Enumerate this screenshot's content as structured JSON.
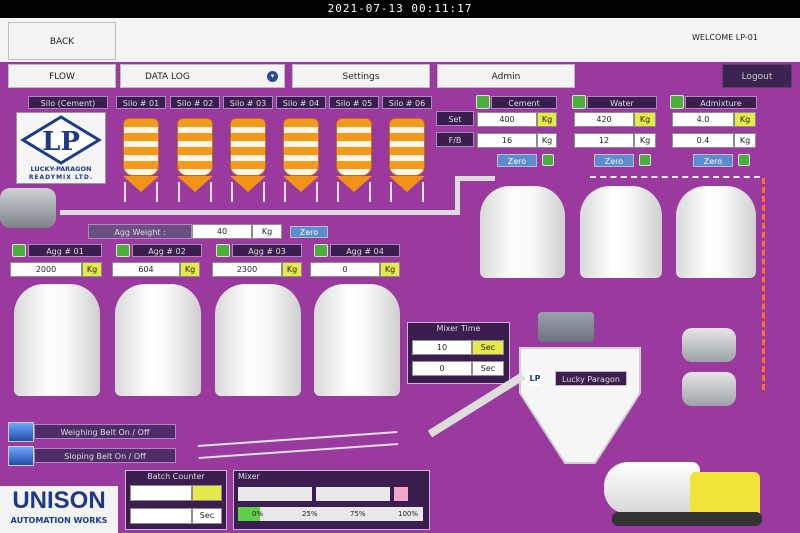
{
  "datetime": "2021-07-13 00:11:17",
  "header": {
    "back_label": "BACK",
    "welcome": "WELCOME LP-01"
  },
  "nav": {
    "flow": "FLOW",
    "dropdown_value": "DATA LOG",
    "settings": "Settings",
    "admin": "Admin",
    "logout": "Logout"
  },
  "silos": {
    "labels": [
      "Silo (Cement)",
      "Silo # 01",
      "Silo # 02",
      "Silo # 03",
      "Silo # 04",
      "Silo # 05",
      "Silo # 06"
    ]
  },
  "logo": {
    "company_line1": "LUCKY-PARAGON",
    "company_line2": "READYMIX LTD."
  },
  "materials": [
    {
      "name": "Cement",
      "set": "400",
      "fb": "16",
      "unit": "Kg"
    },
    {
      "name": "Water",
      "set": "420",
      "fb": "12",
      "unit": "Kg"
    },
    {
      "name": "Admixture",
      "set": "4.0",
      "fb": "0.4",
      "unit": "Kg"
    }
  ],
  "set_label": "Set",
  "fb_label": "F/B",
  "zero_label": "Zero",
  "agg_weight": {
    "label": "Agg Weight :",
    "value": "40",
    "unit": "Kg",
    "zero": "Zero"
  },
  "aggs": [
    {
      "name": "Agg # 01",
      "value": "2000",
      "unit": "Kg"
    },
    {
      "name": "Agg # 02",
      "value": "604",
      "unit": "Kg"
    },
    {
      "name": "Agg # 03",
      "value": "2300",
      "unit": "Kg"
    },
    {
      "name": "Agg # 04",
      "value": "0",
      "unit": "Kg"
    }
  ],
  "mixer_time": {
    "title": "Mixer Time",
    "v1": "10",
    "u1": "Sec",
    "v2": "0",
    "u2": "Sec"
  },
  "mixer_label": "Lucky Paragon",
  "weighing_belt": "Weighing Belt On / Off",
  "sloping_belt": "Sloping Belt On / Off",
  "batch_counter": {
    "title": "Batch Counter",
    "unit": "Sec"
  },
  "mixer": {
    "title": "Mixer",
    "ticks": [
      "0%",
      "25%",
      "75%",
      "100%"
    ],
    "progress": 0.12
  },
  "brand": {
    "line1": "UNISON",
    "line2": "AUTOMATION WORKS"
  },
  "colors": {
    "accent_purple": "#9a3a9e",
    "indicator_green": "#4caf3a",
    "unit_yellow": "#e6e94a"
  }
}
